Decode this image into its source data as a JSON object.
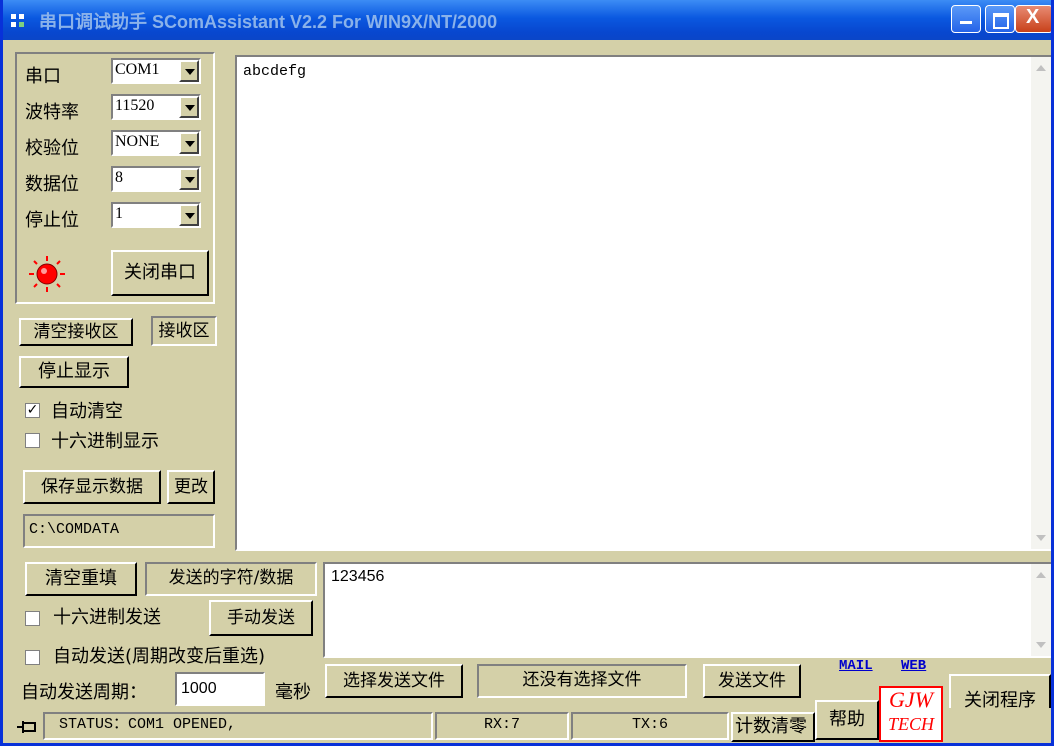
{
  "window": {
    "title": "串口调试助手 SComAssistant V2.2 For WIN9X/NT/2000"
  },
  "serial_config": {
    "port_label": "串口",
    "port_value": "COM1",
    "baud_label": "波特率",
    "baud_value": "11520",
    "parity_label": "校验位",
    "parity_value": "NONE",
    "databits_label": "数据位",
    "databits_value": "8",
    "stopbits_label": "停止位",
    "stopbits_value": "1",
    "close_port_button": "关闭串口"
  },
  "receive_controls": {
    "clear_receive_button": "清空接收区",
    "receive_area_label": "接收区",
    "stop_display_button": "停止显示",
    "auto_clear_label": "自动清空",
    "auto_clear_checked": true,
    "hex_display_label": "十六进制显示",
    "hex_display_checked": false,
    "save_data_button": "保存显示数据",
    "change_button": "更改",
    "save_path": "C:\\COMDATA"
  },
  "receive_area": {
    "text": "abcdefg"
  },
  "send_controls": {
    "clear_refill_button": "清空重填",
    "send_chars_label": "发送的字符/数据",
    "hex_send_label": "十六进制发送",
    "hex_send_checked": false,
    "manual_send_button": "手动发送",
    "auto_send_label": "自动发送(周期改变后重选)",
    "auto_send_checked": false,
    "period_label": "自动发送周期：",
    "period_value": "1000",
    "period_unit": "毫秒"
  },
  "send_area": {
    "text": "123456"
  },
  "file_controls": {
    "select_file_button": "选择发送文件",
    "file_status": "还没有选择文件",
    "send_file_button": "发送文件"
  },
  "links": {
    "mail": "MAIL",
    "web": "WEB"
  },
  "logo": {
    "line1": "GJW",
    "line2": "TECH"
  },
  "close_program_button": "关闭程序",
  "help_button": "帮助",
  "reset_count_button": "计数清零",
  "status_bar": {
    "status": "STATUS：COM1 OPENED,",
    "rx": "RX:7",
    "tx": "TX:6"
  },
  "colors": {
    "title_bar": "#0a58e0",
    "panel": "#d4d0a8",
    "led": "#ff0000",
    "link": "#0000cc",
    "logo": "#ff0000"
  }
}
